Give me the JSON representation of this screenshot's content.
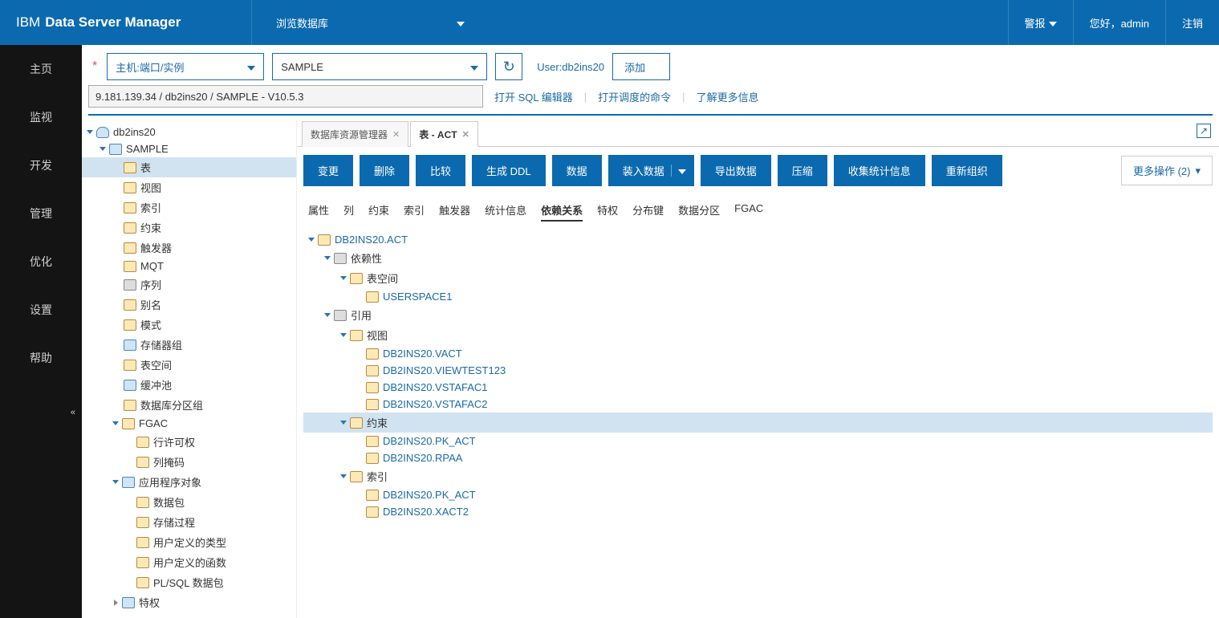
{
  "header": {
    "brand_ibm": "IBM",
    "brand_rest": "Data Server Manager",
    "dropdown_label": "浏览数据库",
    "alerts": "警报",
    "greeting": "您好，admin",
    "logout": "注销"
  },
  "toolbar": {
    "host_select": "主机:端口/实例",
    "db_select": "SAMPLE",
    "user_label": "User:db2ins20",
    "add_label": "添加",
    "path_value": "9.181.139.34 / db2ins20 / SAMPLE - V10.5.3",
    "link_sql": "打开 SQL 编辑器",
    "link_sched": "打开调度的命令",
    "link_learn": "了解更多信息"
  },
  "leftnav": {
    "items": [
      "主页",
      "监视",
      "开发",
      "管理",
      "优化",
      "设置",
      "帮助"
    ]
  },
  "tree": {
    "root": "db2ins20",
    "db": "SAMPLE",
    "folders": [
      "表",
      "视图",
      "索引",
      "约束",
      "触发器",
      "MQT",
      "序列",
      "别名",
      "模式",
      "存储器组",
      "表空间",
      "缓冲池",
      "数据库分区组"
    ],
    "fgac": "FGAC",
    "fgac_children": [
      "行许可权",
      "列掩码"
    ],
    "app": "应用程序对象",
    "app_children": [
      "数据包",
      "存储过程",
      "用户定义的类型",
      "用户定义的函数",
      "PL/SQL 数据包"
    ],
    "priv": "特权"
  },
  "tabs": {
    "t1": "数据库资源管理器",
    "t2": "表 - ACT"
  },
  "actions": {
    "b1": "变更",
    "b2": "删除",
    "b3": "比较",
    "b4": "生成 DDL",
    "b5": "数据",
    "b6": "装入数据",
    "b7": "导出数据",
    "b8": "压缩",
    "b9": "收集统计信息",
    "b10": "重新组织",
    "more": "更多操作 (2)"
  },
  "subtabs": [
    "属性",
    "列",
    "约束",
    "索引",
    "触发器",
    "统计信息",
    "依赖关系",
    "特权",
    "分布键",
    "数据分区",
    "FGAC"
  ],
  "dep": {
    "root": "DB2INS20.ACT",
    "dependency": "依赖性",
    "tablespace": "表空间",
    "tablespace_items": [
      "USERSPACE1"
    ],
    "reference": "引用",
    "view": "视图",
    "view_items": [
      "DB2INS20.VACT",
      "DB2INS20.VIEWTEST123",
      "DB2INS20.VSTAFAC1",
      "DB2INS20.VSTAFAC2"
    ],
    "constraint": "约束",
    "constraint_items": [
      "DB2INS20.PK_ACT",
      "DB2INS20.RPAA"
    ],
    "index": "索引",
    "index_items": [
      "DB2INS20.PK_ACT",
      "DB2INS20.XACT2"
    ]
  }
}
